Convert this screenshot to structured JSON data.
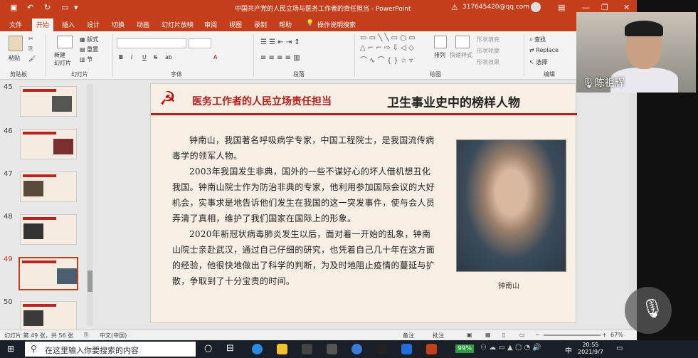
{
  "window": {
    "title": "中国共产党的人民立场与医务工作者的责任担当 - PowerPoint",
    "account": "317645420@qq.com",
    "warning": "⚠"
  },
  "tabs": [
    "文件",
    "开始",
    "插入",
    "设计",
    "切换",
    "动画",
    "幻灯片放映",
    "审阅",
    "视图",
    "录制",
    "帮助",
    "操作说明搜索"
  ],
  "ribbon": {
    "clipboard": {
      "paste": "粘贴",
      "label": "剪贴板"
    },
    "slides": {
      "new": "新建\n幻灯片",
      "layout": "版式",
      "reset": "重置",
      "section": "节",
      "label": "幻灯片"
    },
    "font": {
      "label": "字体",
      "bold": "B",
      "italic": "I",
      "underline": "U",
      "strike": "S",
      "shadow": "ab"
    },
    "paragraph": {
      "label": "段落"
    },
    "drawing": {
      "arrange": "排列",
      "quickstyle": "快速样式",
      "fill": "形状填充",
      "outline": "形状轮廓",
      "effect": "形状效果",
      "label": "绘图"
    },
    "editing": {
      "find": "查找",
      "replace": "Replace",
      "select": "选择",
      "label": "编辑"
    }
  },
  "thumbnails": [
    {
      "num": "45"
    },
    {
      "num": "46"
    },
    {
      "num": "47"
    },
    {
      "num": "48"
    },
    {
      "num": "49",
      "selected": true
    },
    {
      "num": "50"
    }
  ],
  "slide": {
    "title": "医务工作者的人民立场责任担当",
    "subtitle": "卫生事业史中的榜样人物",
    "paragraphs": [
      "钟南山，我国著名呼吸病学专家，中国工程院士，是我国流传病毒学的领军人物。",
      "2003年我国发生非典，国外的一些不谋好心的坏人借机想丑化我国。钟南山院士作为防治非典的专家，他利用参加国际会议的大好机会，实事求是地告诉他们发生在我国的这一突发事件，使与会人员弄清了真相，维护了我们国家在国际上的形象。",
      "2020年新冠状病毒肺炎发生以后，面对着一开始的乱象，钟南山院士亲赴武汉，通过自己仔细的研究，也凭着自己几十年在这方面的经验，他很快地做出了科学的判断，为及时地阻止疫情的蔓延与扩散，争取到了十分宝贵的时间。"
    ],
    "caption": "钟南山"
  },
  "status": {
    "slide_count": "幻灯片 第 49 张，共 56 张",
    "language": "中文(中国)",
    "notes": "备注",
    "comments": "批注",
    "zoom": "67%"
  },
  "taskbar": {
    "search": "在这里输入你要搜索的内容",
    "battery": "99%",
    "ime": "中",
    "time": "20:55",
    "date": "2021/9/7"
  },
  "camera": {
    "name": "陈祖辉"
  }
}
